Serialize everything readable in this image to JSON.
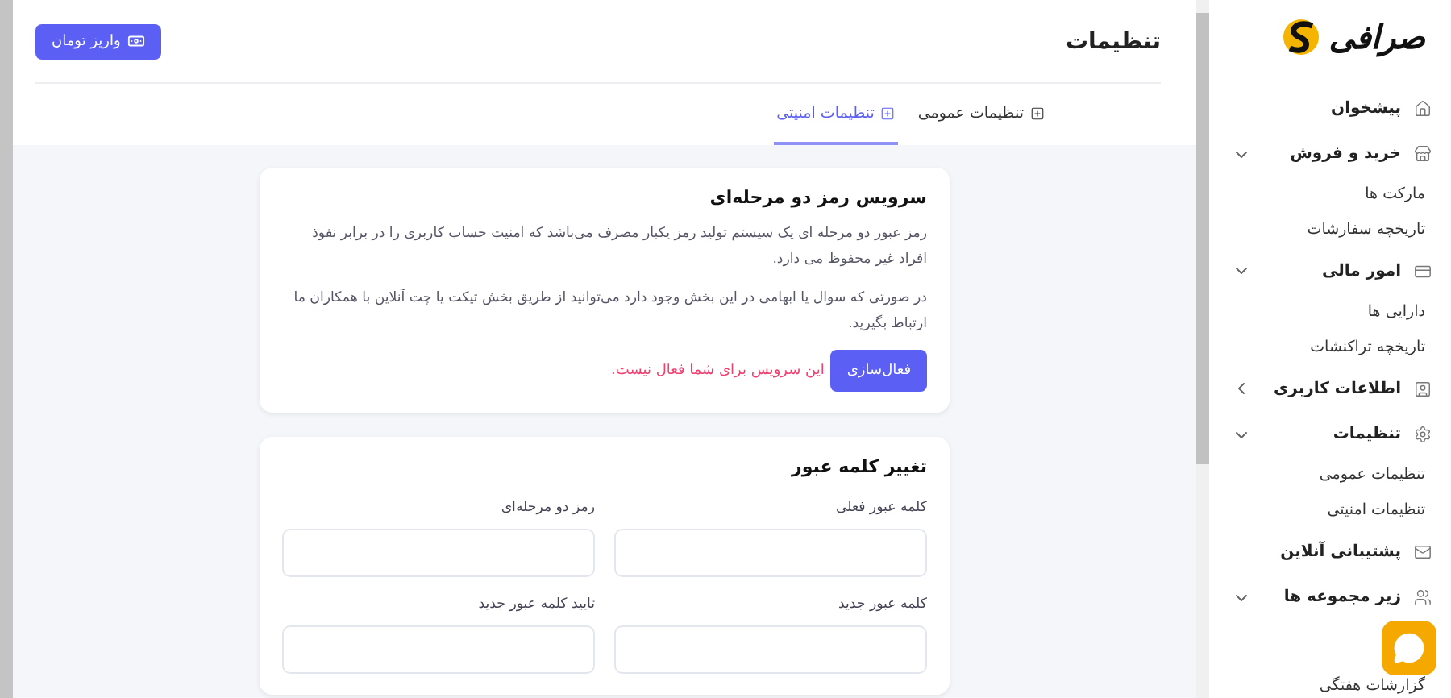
{
  "sidebar": {
    "logo_text": "صرافی",
    "items": [
      {
        "label": "پیشخوان"
      },
      {
        "label": "خرید و فروش",
        "expanded": true,
        "children": [
          {
            "label": "مارکت ها"
          },
          {
            "label": "تاریخچه سفارشات"
          }
        ]
      },
      {
        "label": "امور مالی",
        "expanded": true,
        "children": [
          {
            "label": "دارایی ها"
          },
          {
            "label": "تاریخچه تراکنشات"
          }
        ]
      },
      {
        "label": "اطلاعات کاربری",
        "expanded": false
      },
      {
        "label": "تنظیمات",
        "expanded": true,
        "children": [
          {
            "label": "تنظیمات عمومی"
          },
          {
            "label": "تنظیمات امنیتی"
          }
        ]
      },
      {
        "label": "پشتیبانی آنلاین"
      },
      {
        "label": "زیر مجموعه ها",
        "expanded": true,
        "children": [
          {
            "label": "گزارشات هفتگی"
          }
        ]
      }
    ]
  },
  "header": {
    "title": "تنظیمات",
    "deposit_button": "واریز تومان"
  },
  "tabs": [
    {
      "label": "تنظیمات عمومی",
      "selected": false
    },
    {
      "label": "تنظیمات امنیتی",
      "selected": true
    }
  ],
  "two_factor": {
    "title": "سرویس رمز دو مرحله‌ای",
    "paragraphs": [
      "رمز عبور دو مرحله ای یک سیستم تولید رمز یکبار مصرف می‌باشد که امنیت حساب کاربری را در برابر نفوذ افراد غیر محفوظ می دارد.",
      "در صورتی که سوال یا ابهامی در این بخش وجود دارد می‌توانید از طریق بخش تیکت یا چت آنلاین با همکاران ما ارتباط بگیرید."
    ],
    "activate_button": "فعال‌سازی",
    "status": "این سرویس برای شما فعال نیست."
  },
  "change_password": {
    "title": "تغییر کلمه عبور",
    "fields": [
      {
        "label": "کلمه عبور فعلی"
      },
      {
        "label": "رمز دو مرحله‌ای"
      },
      {
        "label": "کلمه عبور جدید"
      },
      {
        "label": "تایید کلمه عبور جدید"
      }
    ]
  }
}
